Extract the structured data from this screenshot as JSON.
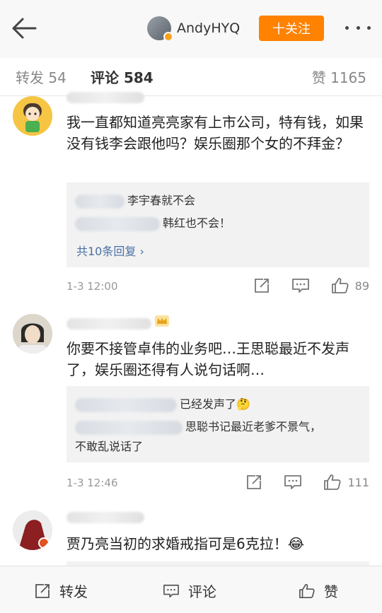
{
  "header": {
    "author_name": "AndyHYQ",
    "follow_label": "十关注",
    "icons": [
      "back-arrow-icon",
      "more-dots-icon"
    ]
  },
  "tabs": {
    "repost": "转发 54",
    "comments": "评论 584",
    "likes": "赞 1165"
  },
  "comments": [
    {
      "text": "我一直都知道亮亮家有上市公司，特有钱，如果没有钱李会跟他吗？娱乐圈那个女的不拜金？",
      "replies": [
        "李宇春就不会",
        "韩红也不会！"
      ],
      "more_replies": "共10条回复 ›",
      "time": "1-3 12:00",
      "likes": "89"
    },
    {
      "text": "你要不接管卓伟的业务吧…王思聪最近不发声了，娱乐圈还得有人说句话啊…",
      "replies": [
        "已经发声了🤔",
        "思聪书记最近老爹不景气，",
        "不敢乱说话了"
      ],
      "time": "1-3 12:46",
      "likes": "111"
    },
    {
      "text": "贾乃亮当初的求婚戒指可是6克拉！😂"
    }
  ],
  "bottom": {
    "repost": "转发",
    "comment": "评论",
    "like": "赞"
  },
  "colors": {
    "accent": "#ff8200",
    "link": "#4a6fa5",
    "meta": "#999999"
  }
}
